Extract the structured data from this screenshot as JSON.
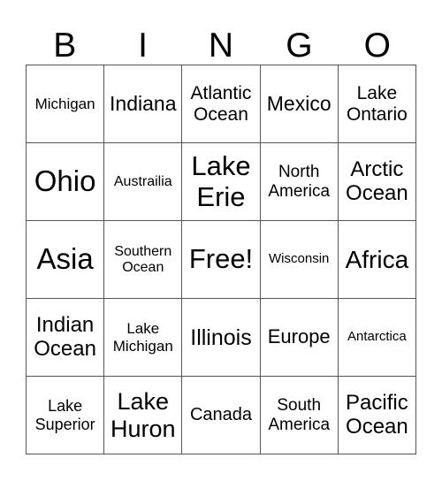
{
  "header": [
    "B",
    "I",
    "N",
    "G",
    "O"
  ],
  "cells": [
    {
      "text": "Michigan",
      "size": 17
    },
    {
      "text": "Indiana",
      "size": 23
    },
    {
      "text": "Atlantic\nOcean",
      "size": 21
    },
    {
      "text": "Mexico",
      "size": 23
    },
    {
      "text": "Lake\nOntario",
      "size": 21
    },
    {
      "text": "Ohio",
      "size": 33
    },
    {
      "text": "Austrailia",
      "size": 16
    },
    {
      "text": "Lake\nErie",
      "size": 31
    },
    {
      "text": "North\nAmerica",
      "size": 19
    },
    {
      "text": "Arctic\nOcean",
      "size": 24
    },
    {
      "text": "Asia",
      "size": 33
    },
    {
      "text": "Southern\nOcean",
      "size": 16
    },
    {
      "text": "Free!",
      "size": 31
    },
    {
      "text": "Wisconsin",
      "size": 15
    },
    {
      "text": "Africa",
      "size": 28
    },
    {
      "text": "Indian\nOcean",
      "size": 24
    },
    {
      "text": "Lake\nMichigan",
      "size": 17
    },
    {
      "text": "Illinois",
      "size": 25
    },
    {
      "text": "Europe",
      "size": 22
    },
    {
      "text": "Antarctica",
      "size": 15
    },
    {
      "text": "Lake\nSuperior",
      "size": 18
    },
    {
      "text": "Lake\nHuron",
      "size": 27
    },
    {
      "text": "Canada",
      "size": 20
    },
    {
      "text": "South\nAmerica",
      "size": 19
    },
    {
      "text": "Pacific\nOcean",
      "size": 24
    }
  ]
}
